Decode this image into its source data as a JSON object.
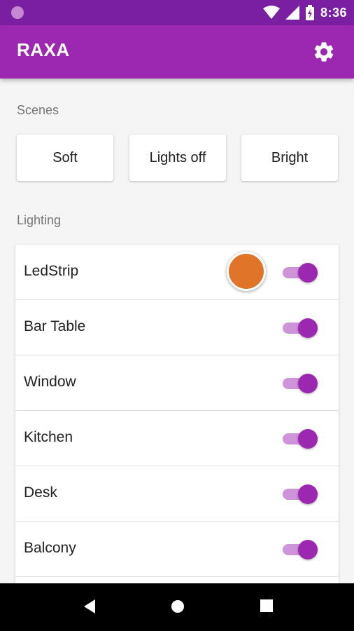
{
  "status_bar": {
    "time": "8:36",
    "icons": [
      "notification-dot-icon",
      "wifi-icon",
      "signal-icon",
      "battery-icon"
    ]
  },
  "app_bar": {
    "title": "RAXA",
    "action_icon": "gear-icon",
    "color": "#9c27b0"
  },
  "scenes": {
    "title": "Scenes",
    "buttons": [
      {
        "label": "Soft"
      },
      {
        "label": "Lights off"
      },
      {
        "label": "Bright"
      }
    ]
  },
  "lighting": {
    "title": "Lighting",
    "items": [
      {
        "label": "LedStrip",
        "on": true,
        "color": "#e0752a"
      },
      {
        "label": "Bar Table",
        "on": true
      },
      {
        "label": "Window",
        "on": true
      },
      {
        "label": "Kitchen",
        "on": true
      },
      {
        "label": "Desk",
        "on": true
      },
      {
        "label": "Balcony",
        "on": true
      }
    ]
  },
  "nav_bar": {
    "icons": [
      "back-icon",
      "home-icon",
      "recents-icon"
    ]
  },
  "colors": {
    "status_bar": "#7b1fa2",
    "accent": "#9c27b0",
    "switch_track": "#ce93d8"
  }
}
